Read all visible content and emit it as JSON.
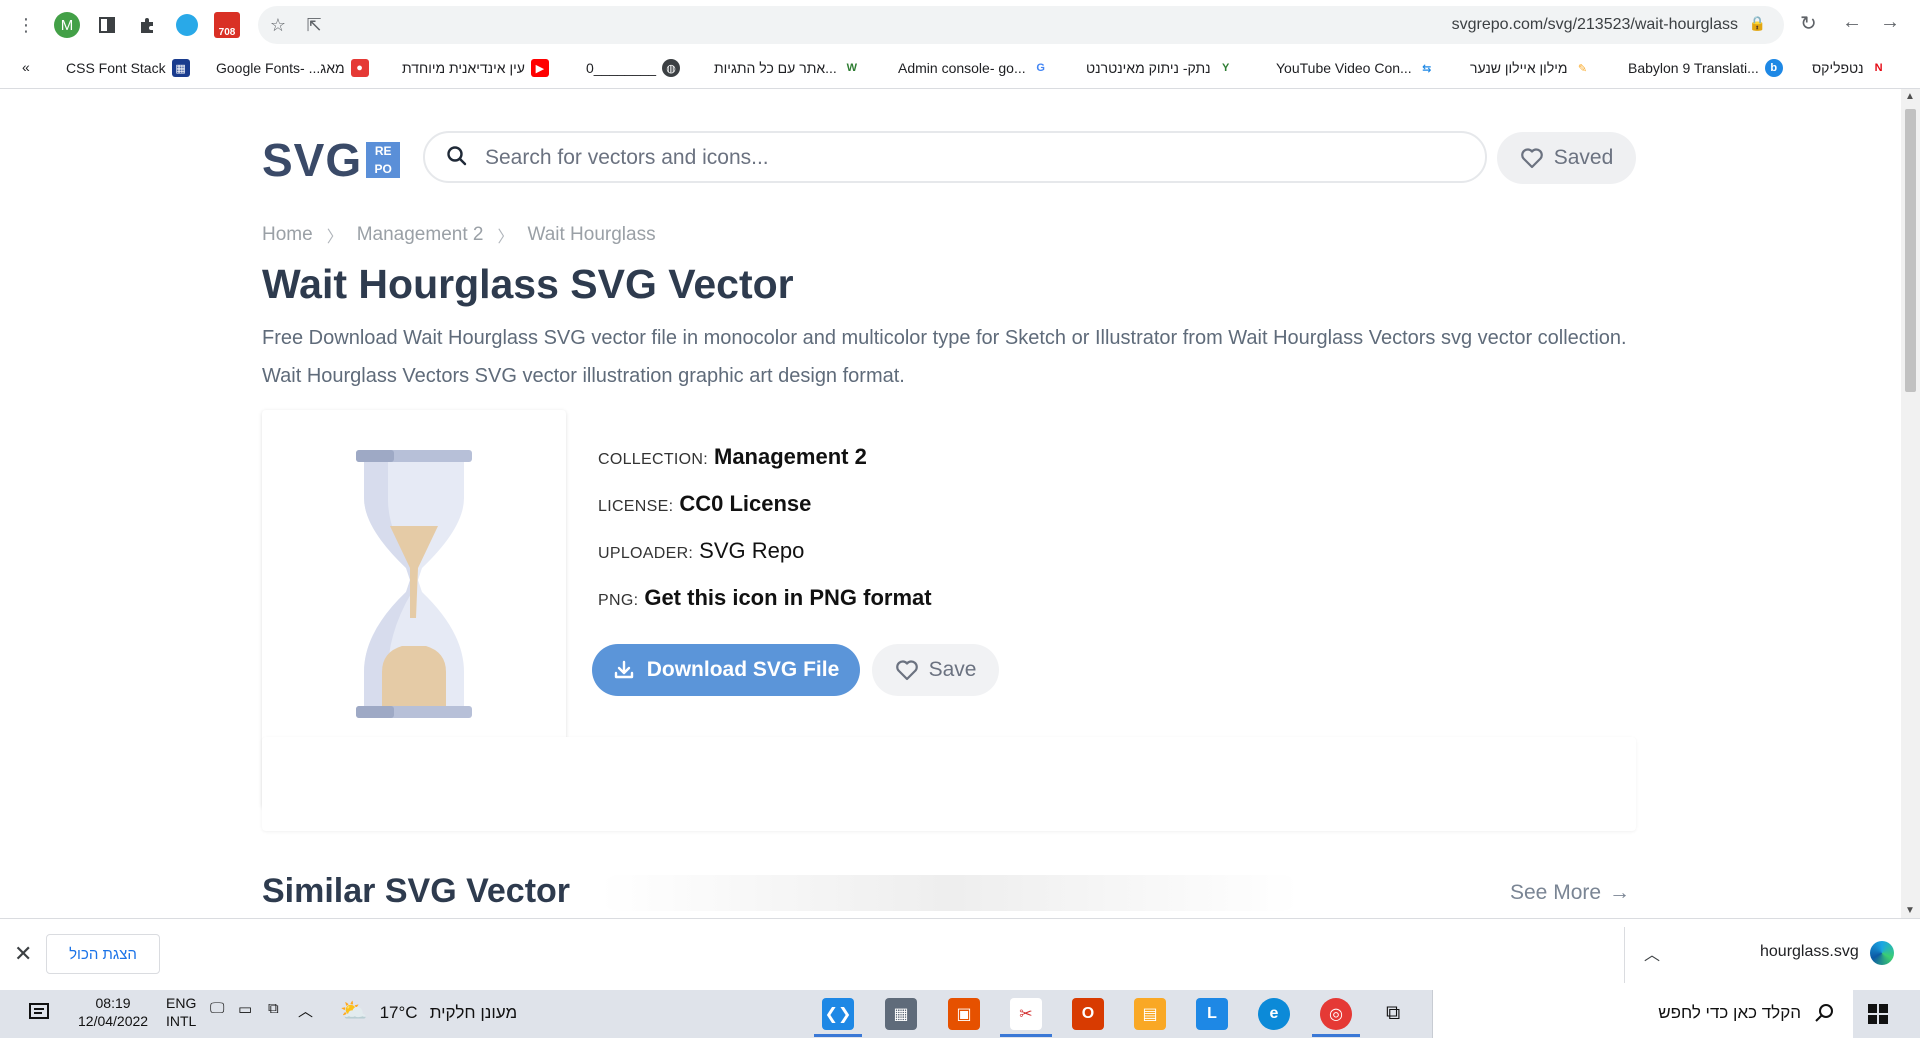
{
  "browser": {
    "url": "svgrepo.com/svg/213523/wait-hourglass",
    "gmail_badge": "708",
    "profile_initial": "M"
  },
  "bookmarks": [
    {
      "label": "CSS Font Stack"
    },
    {
      "label": "Google Fonts- ...מאג"
    },
    {
      "label": "עין אינדיאנית מיוחדת"
    },
    {
      "label": "0________"
    },
    {
      "label": "אתר עם כל התגיות..."
    },
    {
      "label": "Admin console- go..."
    },
    {
      "label": "נתק- ניתוק מאינטרנט"
    },
    {
      "label": "YouTube Video Con..."
    },
    {
      "label": "מילון איילון שנער"
    },
    {
      "label": "Babylon 9 Translati..."
    },
    {
      "label": "נטפליקס"
    }
  ],
  "site": {
    "logo_text": "SVG",
    "logo_badge": [
      "RE",
      "PO"
    ],
    "search_placeholder": "Search for vectors and icons...",
    "saved_label": "Saved"
  },
  "breadcrumb": [
    "Home",
    "Management 2",
    "Wait Hourglass"
  ],
  "page": {
    "title": "Wait Hourglass SVG Vector",
    "description": "Free Download Wait Hourglass SVG vector file in monocolor and multicolor type for Sketch or Illustrator from Wait Hourglass Vectors svg vector collection. Wait Hourglass Vectors SVG vector illustration graphic art design format."
  },
  "meta": {
    "collection_key": "COLLECTION:",
    "collection_value": "Management 2",
    "license_key": "LICENSE:",
    "license_value": "CC0 License",
    "uploader_key": "UPLOADER:",
    "uploader_value": "SVG Repo",
    "png_key": "PNG:",
    "png_value": "Get this icon in PNG format"
  },
  "actions": {
    "download_label": "Download SVG File",
    "save_label": "Save"
  },
  "similar": {
    "heading": "Similar SVG Vector",
    "see_more": "See More"
  },
  "download_bar": {
    "show_all": "הצגת הכול",
    "file_name": "hourglass.svg"
  },
  "taskbar": {
    "time": "08:19",
    "date": "12/04/2022",
    "lang_top": "ENG",
    "lang_bottom": "INTL",
    "temperature": "17°C",
    "weather_text": "מעונן חלקית",
    "search_text": "הקלד כאן כדי לחפש"
  },
  "colors": {
    "accent": "#5b95d9",
    "title": "#2e3b4e",
    "hourglass_frame": "#b7c0d8",
    "hourglass_glass": "#e6eaf5",
    "hourglass_sand": "#e5cba6"
  }
}
